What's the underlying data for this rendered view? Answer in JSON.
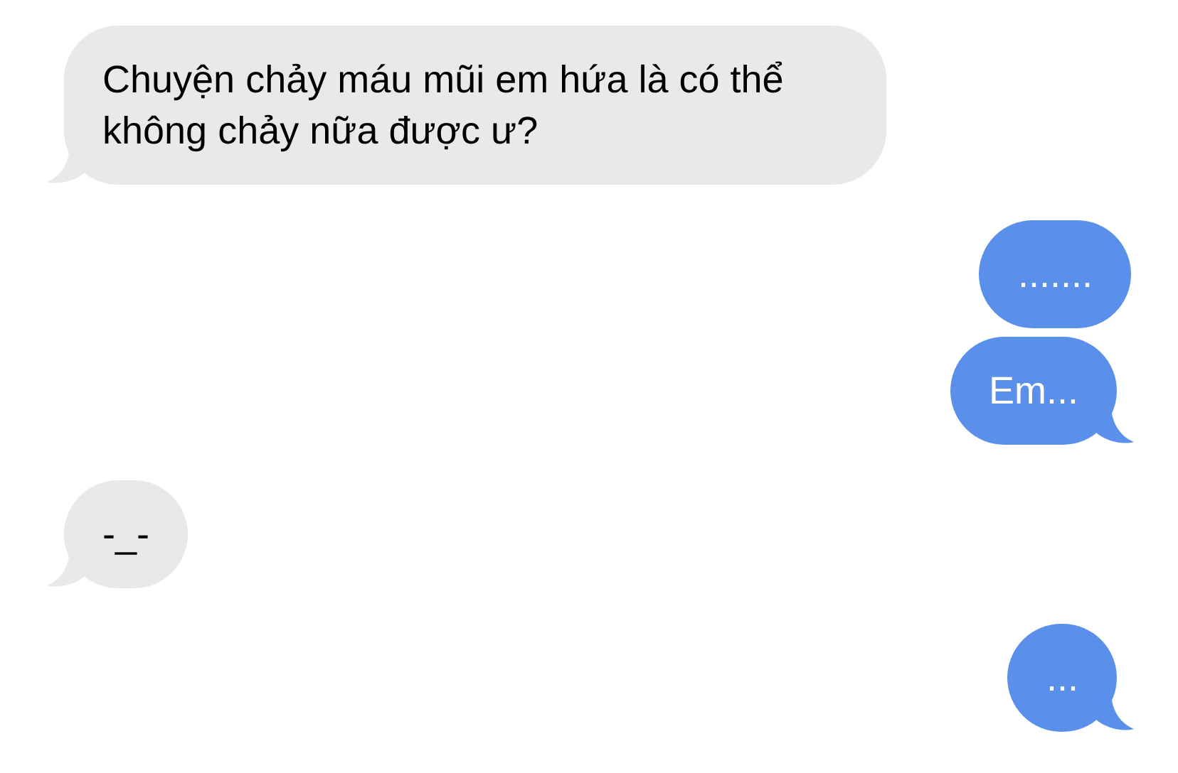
{
  "messages": [
    {
      "kind": "incoming",
      "text": "Chuyện chảy máu mũi em hứa là có thể không chảy nữa được ư?",
      "tail": true
    },
    {
      "kind": "outgoing",
      "text": ".......",
      "tail": false
    },
    {
      "kind": "outgoing",
      "text": "Em...",
      "tail": true
    },
    {
      "kind": "incoming",
      "text": "-_-",
      "tail": true
    },
    {
      "kind": "outgoing",
      "text": "...",
      "tail": true
    }
  ]
}
